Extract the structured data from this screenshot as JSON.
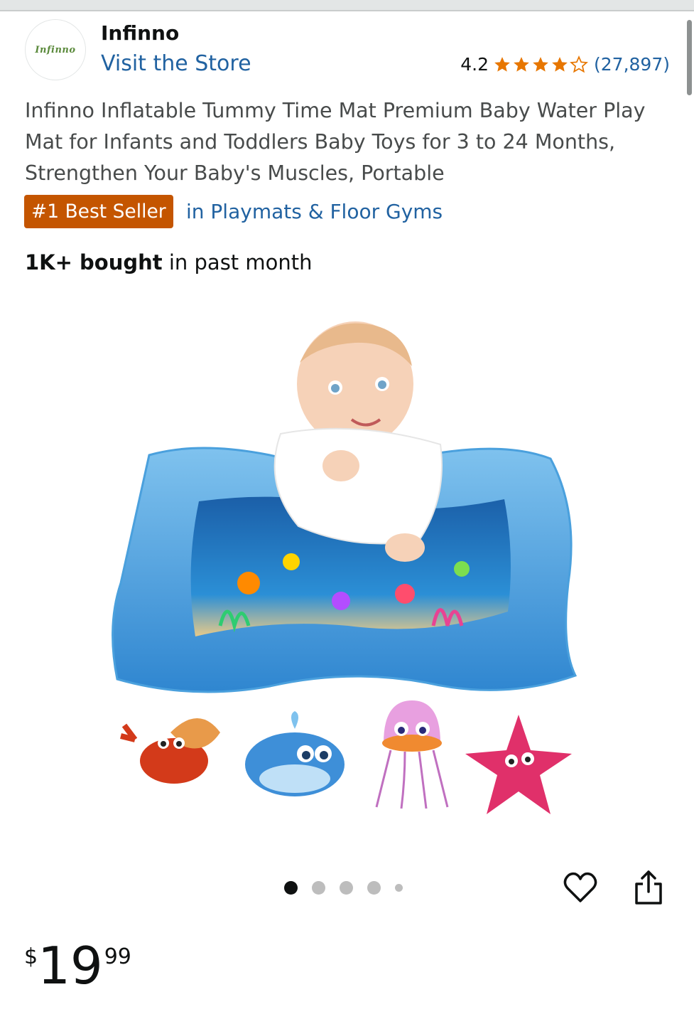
{
  "seller": {
    "logo_text": "Infinno",
    "name": "Infinno",
    "store_link": "Visit the Store"
  },
  "rating": {
    "value": "4.2",
    "stars_out_of_5": 4.2,
    "count": "(27,897)"
  },
  "product": {
    "title": "Infinno Inflatable Tummy Time Mat Premium Baby Water Play Mat for Infants and Toddlers Baby Toys for 3 to 24 Months, Strengthen Your Baby's Muscles, Portable",
    "badge": "#1 Best Seller",
    "category": "in Playmats & Floor Gyms",
    "bought_bold": "1K+ bought",
    "bought_rest": " in past month"
  },
  "gallery": {
    "dot_count": 5,
    "active_index": 0
  },
  "actions": {
    "favorite_icon": "heart-icon",
    "share_icon": "share-icon"
  },
  "price": {
    "symbol": "$",
    "whole": "19",
    "fraction": "99"
  },
  "colors": {
    "link": "#2162a1",
    "badge_bg": "#c45500",
    "star": "#e77600"
  }
}
